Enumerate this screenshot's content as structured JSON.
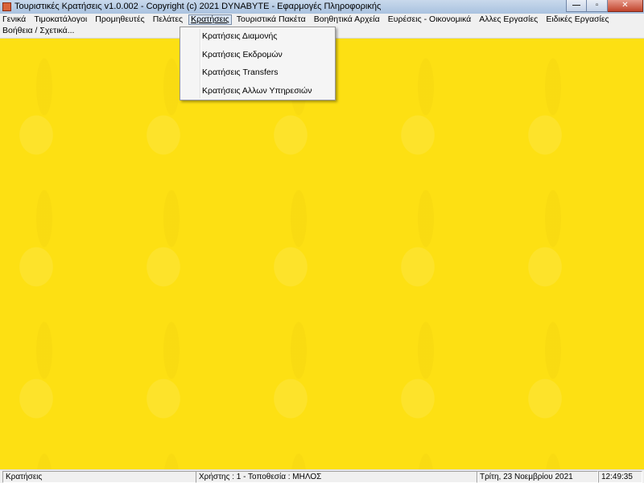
{
  "window": {
    "title": "Τουριστικές Κρατήσεις  v1.0.002  -  Copyright (c)  2021  DYNABYTE - Εφαρμογές Πληροφορικής",
    "minimize_glyph": "—",
    "maximize_glyph": "▫",
    "close_glyph": "✕"
  },
  "menu": {
    "row1": [
      "Γενικά",
      "Τιμοκατάλογοι",
      "Προμηθευτές",
      "Πελάτες",
      "Κρατήσεις",
      "Τουριστικά Πακέτα",
      "Βοηθητικά Αρχεία",
      "Ευρέσεις - Οικονομικά",
      "Αλλες Εργασίες",
      "Ειδικές Εργασίες"
    ],
    "row2": [
      "Βοήθεια / Σχετικά..."
    ],
    "active": "Κρατήσεις"
  },
  "dropdown": {
    "items": [
      "Κρατήσεις Διαμονής",
      "Κρατήσεις Εκδρομών",
      "Κρατήσεις Transfers",
      "Κρατήσεις Αλλων Υπηρεσιών"
    ]
  },
  "status": {
    "section": "Κρατήσεις",
    "user_location": "Χρήστης : 1   -  Τοποθεσία : ΜΗΛΟΣ",
    "date": "Τρίτη, 23 Νοεμβρίου 2021",
    "time": "12:49:35"
  },
  "colors": {
    "workspace_bg": "#fde013"
  }
}
